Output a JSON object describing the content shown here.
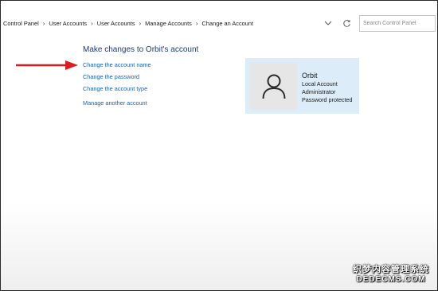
{
  "breadcrumb": {
    "items": [
      "Control Panel",
      "User Accounts",
      "User Accounts",
      "Manage Accounts",
      "Change an Account"
    ],
    "separator": "›"
  },
  "search": {
    "placeholder": "Search Control Panel"
  },
  "main": {
    "heading": "Make changes to Orbit's account",
    "links": [
      "Change the account name",
      "Change the password",
      "Change the account type",
      "Manage another account"
    ]
  },
  "account": {
    "name": "Orbit",
    "details": [
      "Local Account",
      "Administrator",
      "Password protected"
    ]
  },
  "watermark": {
    "line1": "织梦内容管理系统",
    "line2": "DEDECMS.COM"
  },
  "colors": {
    "link": "#1a63b8",
    "heading": "#1c3c78",
    "tile_bg": "#dcecf8",
    "arrow": "#d81e1e"
  },
  "icons": [
    "chevron-down-icon",
    "refresh-icon",
    "user-avatar-icon",
    "red-arrow-annotation"
  ]
}
